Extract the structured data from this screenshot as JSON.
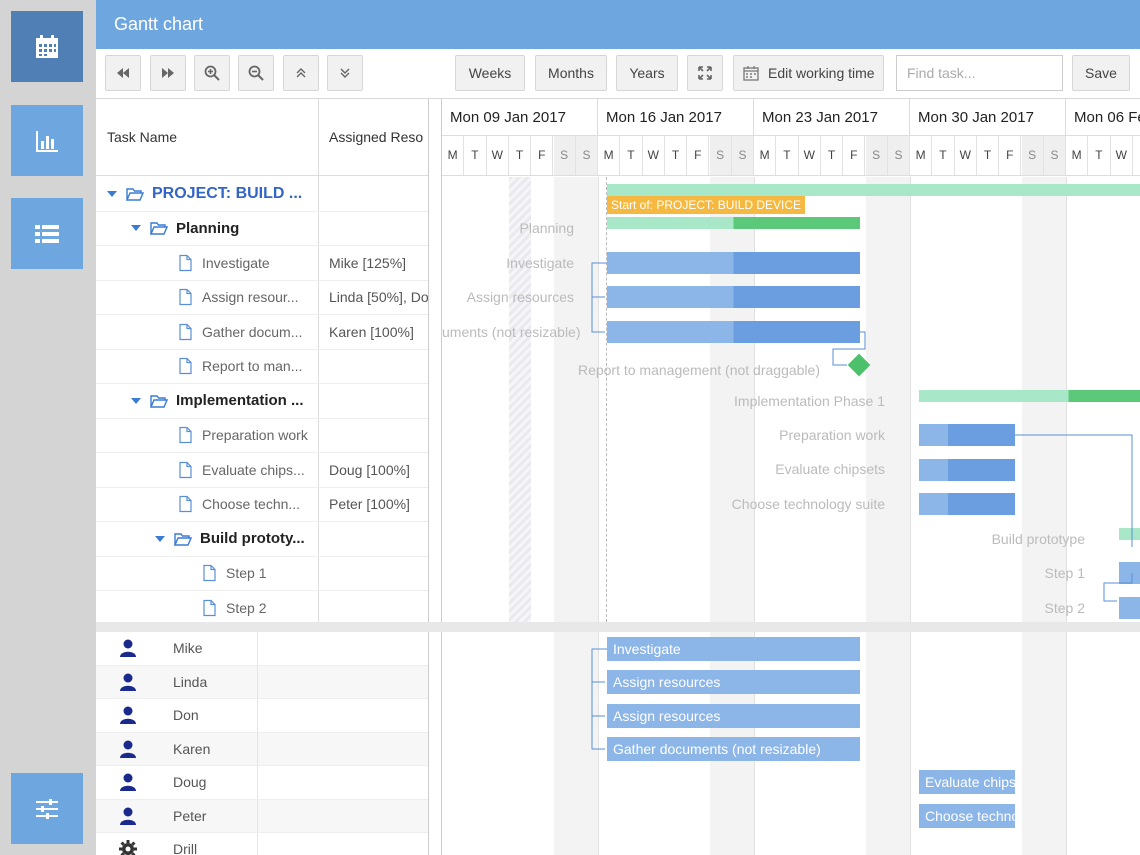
{
  "header": {
    "title": "Gantt chart"
  },
  "toolbar": {
    "weeks_label": "Weeks",
    "months_label": "Months",
    "years_label": "Years",
    "edit_working_time_label": "Edit working time",
    "find_placeholder": "Find task...",
    "save_label": "Save"
  },
  "columns": {
    "task_name": "Task Name",
    "assigned": "Assigned Reso"
  },
  "tasks": [
    {
      "name": "PROJECT: BUILD ...",
      "resources": "",
      "kind": "project",
      "level": 0
    },
    {
      "name": "Planning",
      "resources": "",
      "kind": "group",
      "level": 1
    },
    {
      "name": "Investigate",
      "resources": "Mike [125%]",
      "kind": "leaf",
      "level": 2
    },
    {
      "name": "Assign resour...",
      "resources": "Linda [50%], Do",
      "kind": "leaf",
      "level": 2
    },
    {
      "name": "Gather docum...",
      "resources": "Karen [100%]",
      "kind": "leaf",
      "level": 2
    },
    {
      "name": "Report to man...",
      "resources": "",
      "kind": "leaf",
      "level": 2
    },
    {
      "name": "Implementation ...",
      "resources": "",
      "kind": "group",
      "level": 1
    },
    {
      "name": "Preparation work",
      "resources": "",
      "kind": "leaf",
      "level": 2
    },
    {
      "name": "Evaluate chips...",
      "resources": "Doug [100%]",
      "kind": "leaf",
      "level": 2
    },
    {
      "name": "Choose techn...",
      "resources": "Peter [100%]",
      "kind": "leaf",
      "level": 2
    },
    {
      "name": "Build prototy...",
      "resources": "",
      "kind": "group",
      "level": 2
    },
    {
      "name": "Step 1",
      "resources": "",
      "kind": "leaf",
      "level": 3
    },
    {
      "name": "Step 2",
      "resources": "",
      "kind": "leaf",
      "level": 3
    }
  ],
  "timeline": {
    "weeks": [
      "Mon 09 Jan 2017",
      "Mon 16 Jan 2017",
      "Mon 23 Jan 2017",
      "Mon 30 Jan 2017",
      "Mon 06 Fe"
    ],
    "day_letters": [
      "M",
      "T",
      "W",
      "T",
      "F",
      "S",
      "S"
    ],
    "start_marker_label": "Start of: PROJECT: BUILD DEVICE",
    "bar_labels": {
      "planning": "Planning",
      "investigate": "Investigate",
      "assign": "Assign resources",
      "gather": "uments (not resizable)",
      "report": "Report to management (not draggable)",
      "implementation": "Implementation Phase 1",
      "preparation": "Preparation work",
      "evaluate": "Evaluate chipsets",
      "choose": "Choose technology suite",
      "prototype": "Build prototype",
      "step1": "Step 1",
      "step2": "Step 2"
    }
  },
  "resources": [
    {
      "name": "Mike",
      "icon": "user-icon"
    },
    {
      "name": "Linda",
      "icon": "user-icon"
    },
    {
      "name": "Don",
      "icon": "user-icon"
    },
    {
      "name": "Karen",
      "icon": "user-icon"
    },
    {
      "name": "Doug",
      "icon": "user-icon"
    },
    {
      "name": "Peter",
      "icon": "user-icon"
    },
    {
      "name": "Drill",
      "icon": "gear-icon"
    }
  ],
  "resource_bars": {
    "mike": "Investigate",
    "linda": "Assign resources",
    "don": "Assign resources",
    "karen": "Gather documents (not resizable)",
    "doug": "Evaluate chipse",
    "peter": "Choose techno"
  },
  "colors": {
    "accent": "#6ea7e0",
    "task_bar": "#6a9ee0",
    "summary": "#a8e8c8",
    "summary_progress": "#5cc87a",
    "milestone": "#4cc06a",
    "start_marker": "#f5b942"
  }
}
